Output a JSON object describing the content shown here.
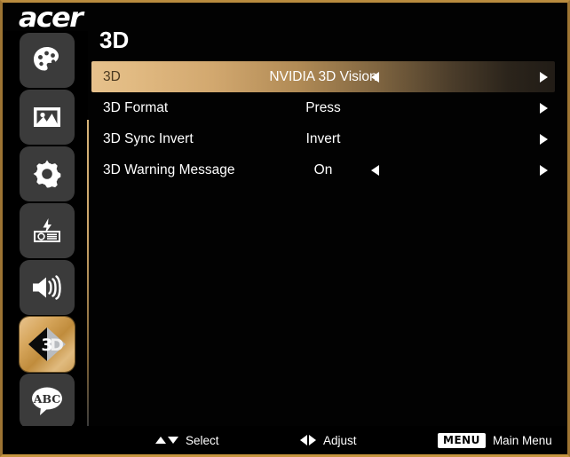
{
  "brand": {
    "logo_text": "acer"
  },
  "colors": {
    "frame_border": "#b8893c",
    "background": "#000000",
    "highlight_start": "#e6c18c",
    "highlight_end": "#211c16",
    "icon_tile": "#3b3b3b",
    "active_icon_tile": "#d8a85f",
    "text": "#ffffff",
    "selected_label_text": "#4b3a21",
    "divider": "#d7b479"
  },
  "sidebar": {
    "items": [
      {
        "icon": "color-palette-icon",
        "name": "sidebar-item-color",
        "active": false
      },
      {
        "icon": "image-icon",
        "name": "sidebar-item-image",
        "active": false
      },
      {
        "icon": "gear-icon",
        "name": "sidebar-item-setting",
        "active": false
      },
      {
        "icon": "projector-lamp-icon",
        "name": "sidebar-item-management",
        "active": false
      },
      {
        "icon": "speaker-icon",
        "name": "sidebar-item-audio",
        "active": false
      },
      {
        "icon": "three-d-icon",
        "name": "sidebar-item-3d",
        "active": true
      },
      {
        "icon": "abc-speech-bubble-icon",
        "name": "sidebar-item-language",
        "active": false
      }
    ]
  },
  "main": {
    "page_title": "3D",
    "rows": [
      {
        "label": "3D",
        "value": "NVIDIA 3D Vision",
        "left_arrow": true,
        "right_arrow": true,
        "selected": true
      },
      {
        "label": "3D Format",
        "value": "Press",
        "left_arrow": false,
        "right_arrow": true,
        "selected": false
      },
      {
        "label": "3D Sync Invert",
        "value": "Invert",
        "left_arrow": false,
        "right_arrow": true,
        "selected": false
      },
      {
        "label": "3D Warning Message",
        "value": "On",
        "left_arrow": true,
        "right_arrow": true,
        "selected": false
      }
    ]
  },
  "footer": {
    "select_label": "Select",
    "adjust_label": "Adjust",
    "menu_badge": "MENU",
    "main_menu_label": "Main Menu"
  }
}
